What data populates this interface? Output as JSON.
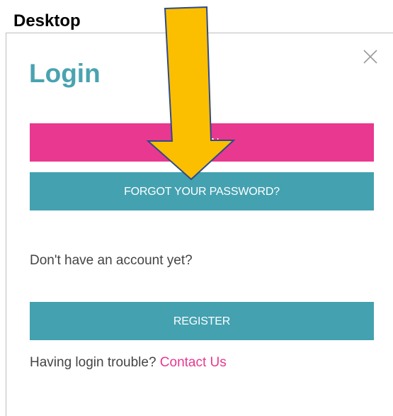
{
  "header": {
    "label": "Desktop"
  },
  "modal": {
    "title": "Login",
    "login_button": "LOGIN",
    "forgot_button": "FORGOT YOUR PASSWORD?",
    "no_account_text": "Don't have an account yet?",
    "register_button": "REGISTER",
    "trouble_text": "Having login trouble? ",
    "contact_link": "Contact Us",
    "close_icon": "close-icon"
  },
  "colors": {
    "title": "#49a3b0",
    "login_button": "#e8388f",
    "teal_button": "#44a1b0",
    "link": "#e8388f",
    "arrow_fill": "#fbbf00",
    "arrow_stroke": "#2f4a8a"
  }
}
